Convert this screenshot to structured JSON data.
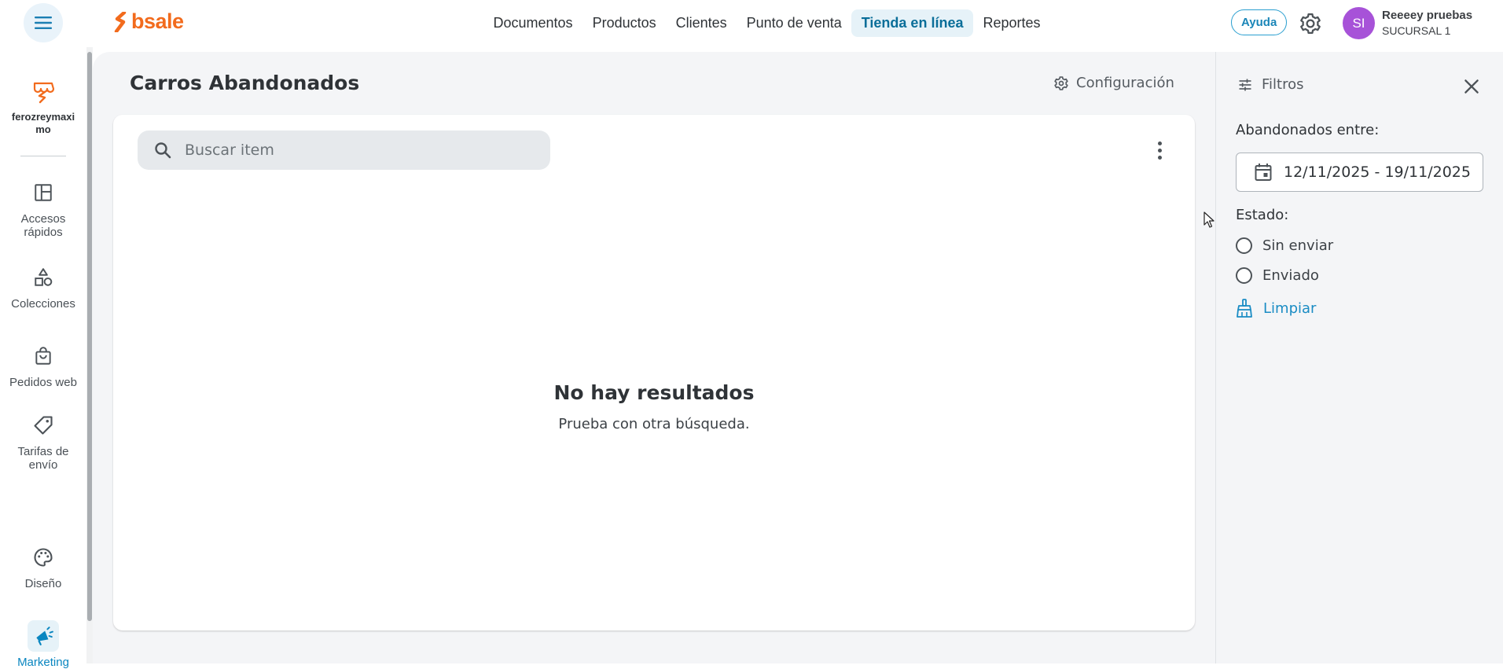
{
  "app": {
    "logo_text": "bsale",
    "brand_color": "#f26b1d",
    "accent_color": "#0a86c0"
  },
  "topnav": {
    "items": [
      {
        "label": "Documentos",
        "active": false
      },
      {
        "label": "Productos",
        "active": false
      },
      {
        "label": "Clientes",
        "active": false
      },
      {
        "label": "Punto de venta",
        "active": false
      },
      {
        "label": "Tienda en línea",
        "active": true
      },
      {
        "label": "Reportes",
        "active": false
      }
    ],
    "help_label": "Ayuda",
    "settings_icon": "gear-icon",
    "menu_icon": "hamburger-icon"
  },
  "user": {
    "initials": "SI",
    "name": "Reeeey pruebas",
    "branch": "SUCURSAL 1",
    "avatar_color": "#a752d8"
  },
  "sidebar": {
    "store_name": "ferozreymaximo",
    "items": [
      {
        "label": "Accesos rápidos",
        "icon": "dashboard-icon",
        "active": false
      },
      {
        "label": "Colecciones",
        "icon": "shapes-icon",
        "active": false
      },
      {
        "label": "Pedidos web",
        "icon": "shopping-bag-icon",
        "active": false
      },
      {
        "label": "Tarifas de envío",
        "icon": "tag-icon",
        "active": false
      },
      {
        "label": "Diseño",
        "icon": "palette-icon",
        "active": false
      },
      {
        "label": "Marketing",
        "icon": "megaphone-icon",
        "active": true
      }
    ]
  },
  "main": {
    "title": "Carros Abandonados",
    "config_label": "Configuración",
    "search_placeholder": "Buscar item",
    "empty_title": "No hay resultados",
    "empty_subtitle": "Prueba con otra búsqueda."
  },
  "filters": {
    "title": "Filtros",
    "date_label": "Abandonados entre:",
    "date_range": "12/11/2025 - 19/11/2025",
    "status_label": "Estado:",
    "status_options": [
      {
        "label": "Sin enviar",
        "selected": false
      },
      {
        "label": "Enviado",
        "selected": false
      }
    ],
    "clear_label": "Limpiar"
  }
}
